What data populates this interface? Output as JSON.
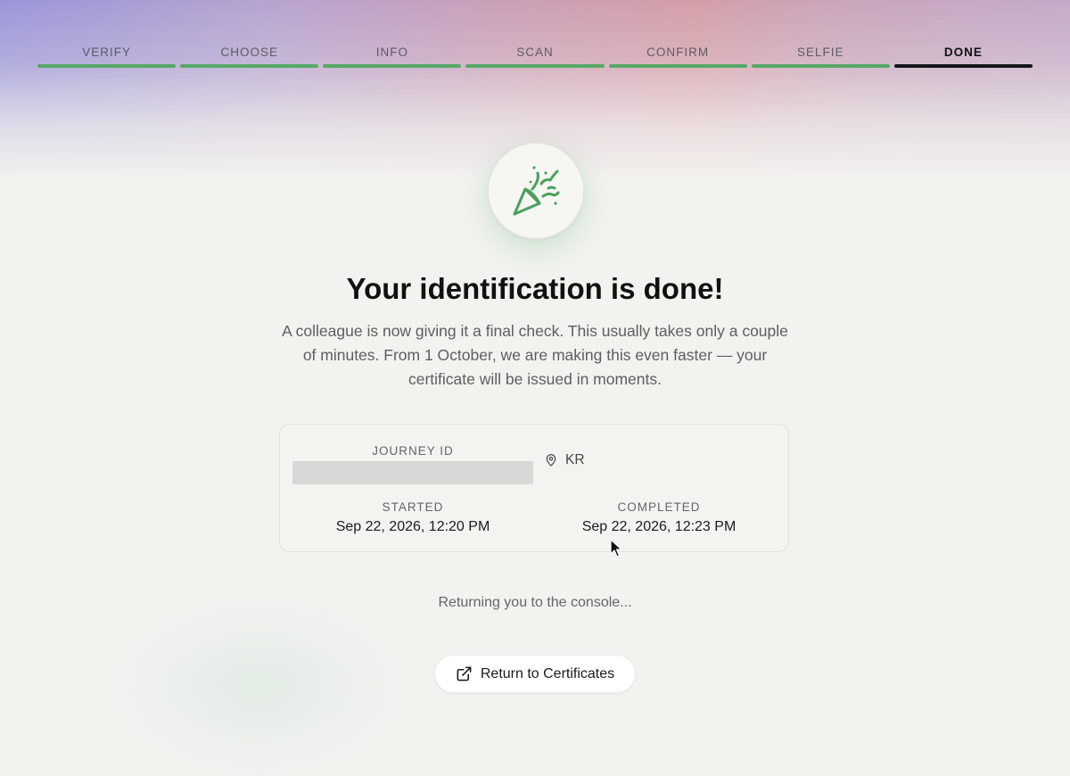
{
  "stepper": {
    "steps": [
      {
        "label": "VERIFY",
        "state": "complete"
      },
      {
        "label": "CHOOSE",
        "state": "complete"
      },
      {
        "label": "INFO",
        "state": "complete"
      },
      {
        "label": "SCAN",
        "state": "complete"
      },
      {
        "label": "CONFIRM",
        "state": "complete"
      },
      {
        "label": "SELFIE",
        "state": "complete"
      },
      {
        "label": "DONE",
        "state": "current"
      }
    ],
    "colors": {
      "complete": "#56a867",
      "current": "#16161a"
    }
  },
  "hero": {
    "icon": "party-popper-icon",
    "title": "Your identification is done!",
    "subtitle": "A colleague is now giving it a final check. This usually takes only a couple of minutes. From 1 October, we are making this even faster — your certificate will be issued in moments."
  },
  "details": {
    "journey_id_label": "JOURNEY ID",
    "journey_id_value": "",
    "location_icon": "map-pin-icon",
    "location": "KR",
    "started_label": "STARTED",
    "started_value": "Sep 22, 2026, 12:20 PM",
    "completed_label": "COMPLETED",
    "completed_value": "Sep 22, 2026, 12:23 PM"
  },
  "status": {
    "text": "Returning you to the console..."
  },
  "actions": {
    "return_icon": "external-link-icon",
    "return_label": "Return to Certificates"
  },
  "theme": {
    "accent_green": "#56a867",
    "background": "#f3f2ef"
  }
}
